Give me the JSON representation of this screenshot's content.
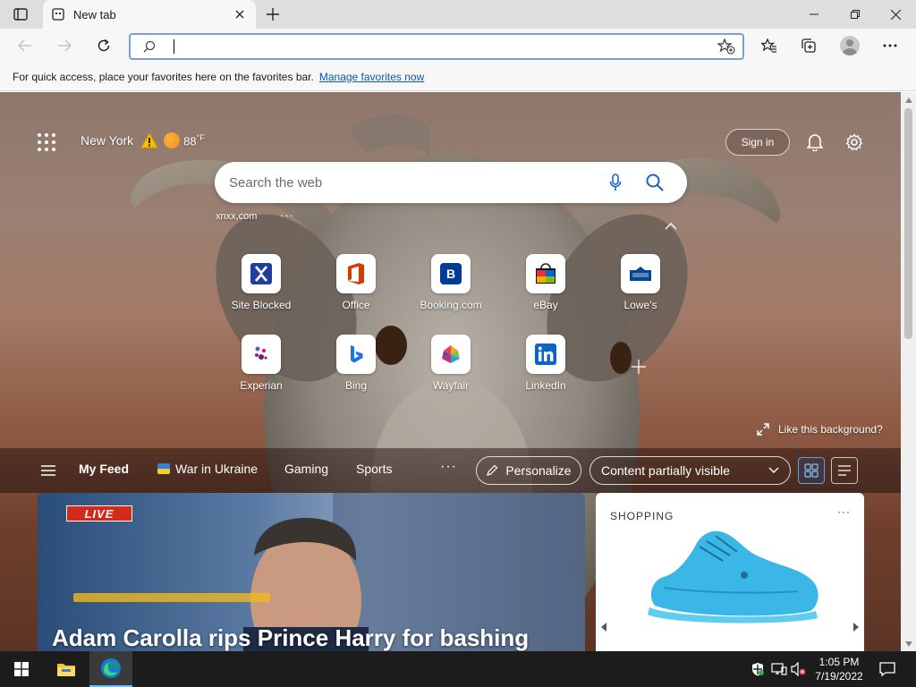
{
  "browser": {
    "tab": {
      "title": "New tab"
    },
    "address_bar": {
      "value": "",
      "placeholder": ""
    },
    "favorites_bar": {
      "message": "For quick access, place your favorites here on the favorites bar.",
      "link_label": "Manage favorites now"
    }
  },
  "newtab": {
    "weather": {
      "city": "New York",
      "temperature": "88",
      "unit": "°F"
    },
    "sign_in_label": "Sign in",
    "search": {
      "placeholder": "Search the web",
      "suggestion": "xnxx,com",
      "more": "···"
    },
    "quick_links": [
      {
        "label": "Site Blocked",
        "icon": "site-blocked-icon"
      },
      {
        "label": "Office",
        "icon": "office-icon"
      },
      {
        "label": "Booking.com",
        "icon": "booking-icon"
      },
      {
        "label": "eBay",
        "icon": "ebay-icon"
      },
      {
        "label": "Lowe's",
        "icon": "lowes-icon"
      },
      {
        "label": "Experian",
        "icon": "experian-icon"
      },
      {
        "label": "Bing",
        "icon": "bing-icon"
      },
      {
        "label": "Wayfair",
        "icon": "wayfair-icon"
      },
      {
        "label": "LinkedIn",
        "icon": "linkedin-icon"
      }
    ],
    "like_background_label": "Like this background?",
    "feed": {
      "tabs": [
        "My Feed",
        "War in Ukraine",
        "Gaming",
        "Sports"
      ],
      "more": "···",
      "personalize_label": "Personalize",
      "visibility_value": "Content partially visible"
    },
    "news_card": {
      "badge": "LIVE",
      "headline": "Adam Carolla rips Prince Harry for bashing"
    },
    "shopping_card": {
      "title": "SHOPPING",
      "more": "···"
    }
  },
  "taskbar": {
    "time": "1:05 PM",
    "date": "7/19/2022"
  },
  "colors": {
    "accent": "#0b57b3",
    "live_red": "#d42a1a",
    "taskbar": "#1c1c1c",
    "shoe": "#3ab7e6"
  }
}
